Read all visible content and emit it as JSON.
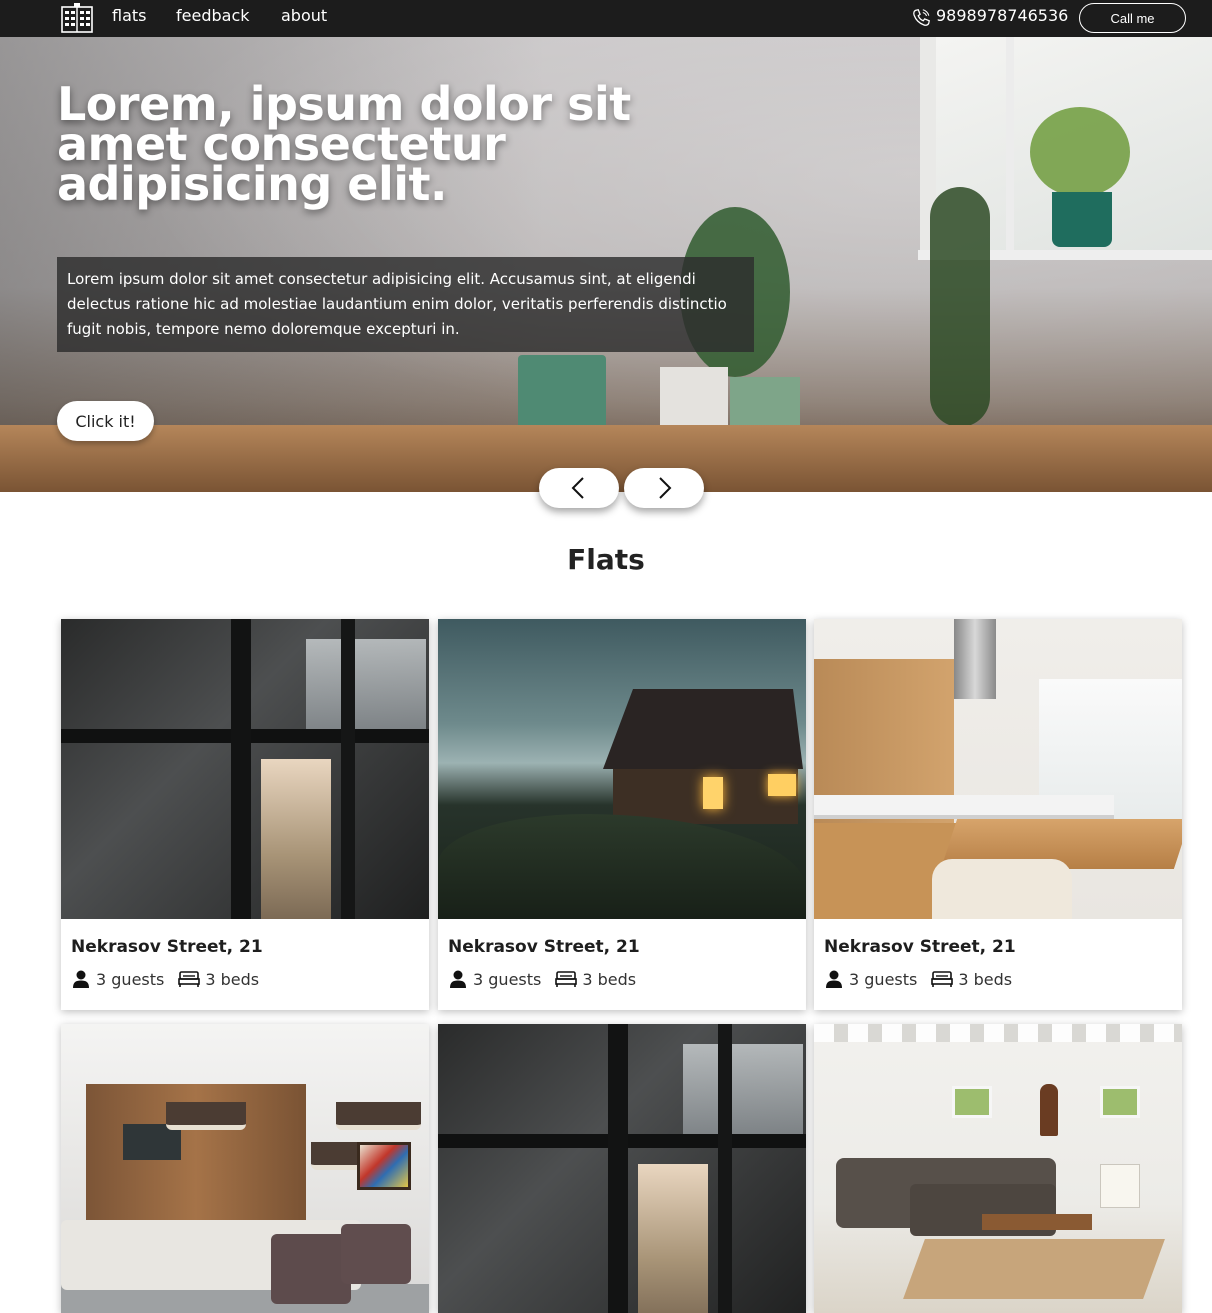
{
  "nav": {
    "links": [
      "flats",
      "feedback",
      "about"
    ],
    "phone": "9898978746536",
    "call_button": "Call me",
    "brand_icon": "building-icon"
  },
  "hero": {
    "title": "Lorem, ipsum dolor sit amet consectetur adipisicing elit.",
    "description": "Lorem ipsum dolor sit amet consectetur adipisicing elit. Accusamus sint, at eligendi delectus ratione hic ad molestiae laudantium enim dolor, veritatis perferendis distinctio fugit nobis, tempore nemo doloremque excepturi in.",
    "cta": "Click it!",
    "prev_icon": "chevron-left-icon",
    "next_icon": "chevron-right-icon"
  },
  "flats": {
    "title": "Flats",
    "cards": [
      {
        "street": "Nekrasov Street, 21",
        "guests": "3 guests",
        "beds": "3 beds"
      },
      {
        "street": "Nekrasov Street, 21",
        "guests": "3 guests",
        "beds": "3 beds"
      },
      {
        "street": "Nekrasov Street, 21",
        "guests": "3 guests",
        "beds": "3 beds"
      },
      {
        "street": "",
        "guests": "",
        "beds": ""
      },
      {
        "street": "",
        "guests": "",
        "beds": ""
      },
      {
        "street": "",
        "guests": "",
        "beds": ""
      }
    ]
  },
  "colors": {
    "navbar": "#1c1c1c",
    "text": "#1b1b1b",
    "hero_overlay": "#2d2d2d"
  }
}
